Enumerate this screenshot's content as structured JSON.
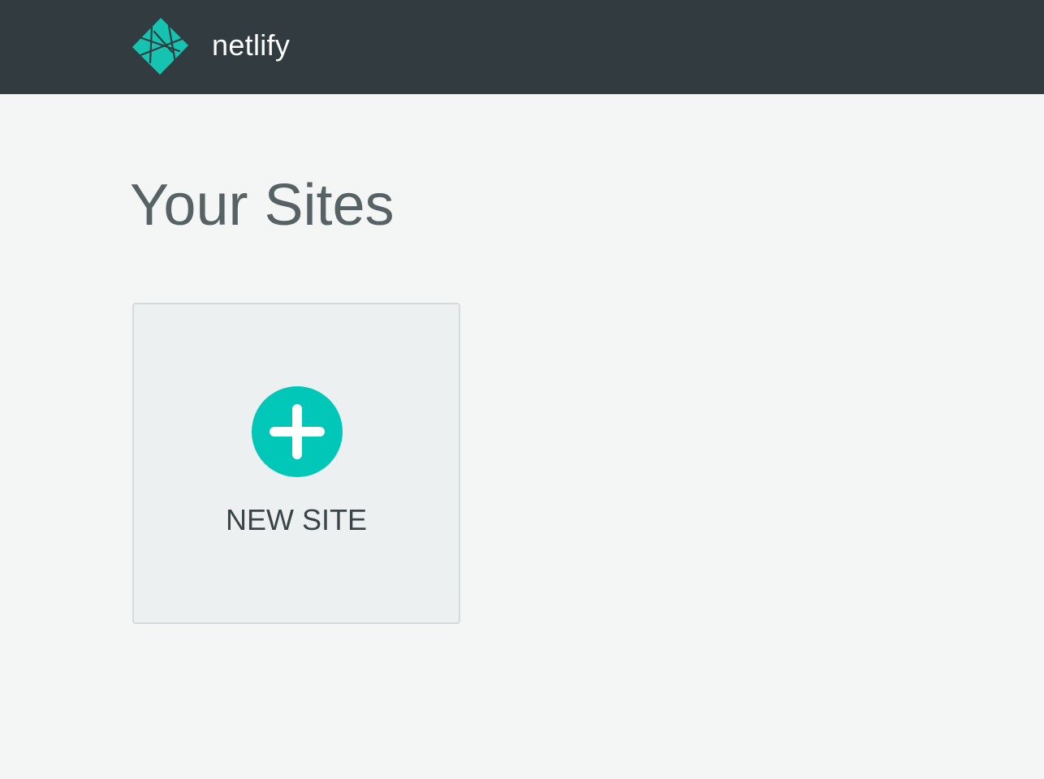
{
  "header": {
    "brand_name": "netlify",
    "logo_icon": "netlify-logo-icon",
    "background_color": "#323b3f",
    "logo_color": "#15c3b0"
  },
  "main": {
    "title": "Your Sites",
    "new_site_card": {
      "icon": "plus-icon",
      "label": "NEW SITE",
      "accent_color": "#00c7b7"
    }
  }
}
